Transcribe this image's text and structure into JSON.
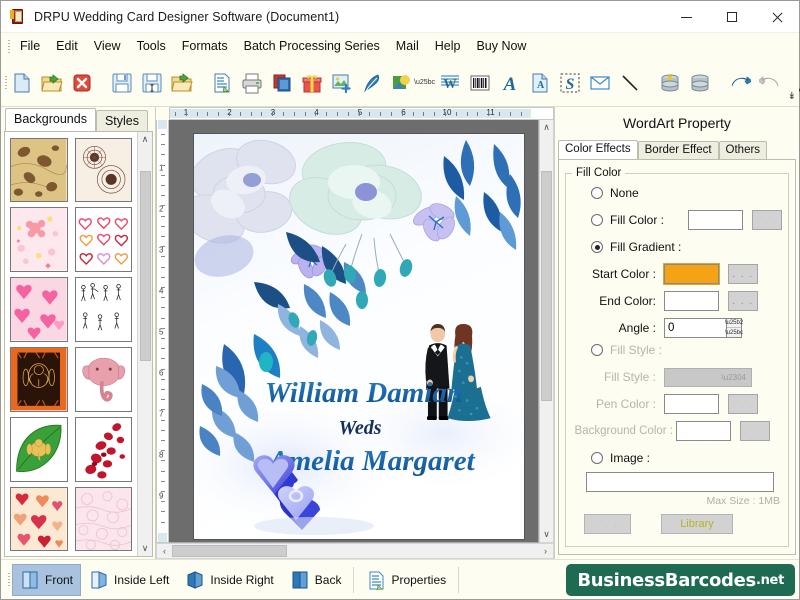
{
  "window": {
    "title": "DRPU Wedding Card Designer Software (Document1)",
    "app_icon": "wedding-card-icon",
    "minimize": "–",
    "maximize": "□",
    "close": "✕"
  },
  "menubar": {
    "items": [
      {
        "label": "File"
      },
      {
        "label": "Edit"
      },
      {
        "label": "View"
      },
      {
        "label": "Tools"
      },
      {
        "label": "Formats"
      },
      {
        "label": "Batch Processing Series"
      },
      {
        "label": "Mail"
      },
      {
        "label": "Help"
      },
      {
        "label": "Buy Now"
      }
    ]
  },
  "toolbar": {
    "overflow": "↡",
    "groups": [
      {
        "buttons": [
          {
            "icon": "new-document-icon",
            "title": "New"
          },
          {
            "icon": "open-folder-icon",
            "title": "Open"
          },
          {
            "icon": "close-document-icon",
            "title": "Close"
          }
        ]
      },
      {
        "buttons": [
          {
            "icon": "save-icon",
            "title": "Save"
          },
          {
            "icon": "save-as-icon",
            "title": "Save As"
          },
          {
            "icon": "export-folder-icon",
            "title": "Export"
          }
        ]
      },
      {
        "buttons": [
          {
            "icon": "print-preview-icon",
            "title": "Print Preview"
          },
          {
            "icon": "printer-icon",
            "title": "Print"
          },
          {
            "icon": "card-templates-icon",
            "title": "Card Templates"
          },
          {
            "icon": "gift-icon",
            "title": "Gift"
          },
          {
            "icon": "add-image-icon",
            "title": "Add Image"
          },
          {
            "icon": "pen-icon",
            "title": "Pen Tool"
          },
          {
            "icon": "shape-picture-icon",
            "title": "Shapes"
          },
          {
            "icon": "watermark-icon",
            "title": "Watermark"
          },
          {
            "icon": "barcode-icon",
            "title": "Barcode"
          },
          {
            "icon": "text-icon",
            "title": "Text"
          },
          {
            "icon": "text-box-icon",
            "title": "Text Box"
          },
          {
            "icon": "wordart-icon",
            "title": "WordArt"
          },
          {
            "icon": "envelope-icon",
            "title": "Envelope"
          },
          {
            "icon": "line-icon",
            "title": "Line"
          }
        ]
      },
      {
        "buttons": [
          {
            "icon": "database-import-icon",
            "title": "Import Database"
          },
          {
            "icon": "database-icon",
            "title": "Database"
          }
        ]
      },
      {
        "buttons": [
          {
            "icon": "undo-icon",
            "title": "Undo"
          },
          {
            "icon": "redo-icon",
            "title": "Redo"
          }
        ]
      },
      {
        "buttons": [
          {
            "icon": "cut-icon",
            "title": "Cut"
          },
          {
            "icon": "copy-icon",
            "title": "Copy"
          },
          {
            "icon": "paste-icon",
            "title": "Paste"
          },
          {
            "icon": "delete-icon",
            "title": "Delete"
          }
        ]
      }
    ]
  },
  "left_panel": {
    "tabs": [
      {
        "label": "Backgrounds",
        "active": true
      },
      {
        "label": "Styles",
        "active": false
      }
    ],
    "thumbnails": [
      {
        "name": "vintage-butterfly-gold"
      },
      {
        "name": "brown-lace-doily"
      },
      {
        "name": "pink-pastel-flowers"
      },
      {
        "name": "heart-outlines-colored"
      },
      {
        "name": "pink-hearts"
      },
      {
        "name": "wedding-couple-sketch"
      },
      {
        "name": "orange-ganesha-motif"
      },
      {
        "name": "pink-elephant"
      },
      {
        "name": "green-leaf-ganesha"
      },
      {
        "name": "red-rose-petals"
      },
      {
        "name": "heart-pattern-collage"
      },
      {
        "name": "pink-damask-texture"
      }
    ],
    "scroll_up": "∧",
    "scroll_down": "∨"
  },
  "canvas": {
    "h_ruler_labels": [
      "1",
      "2",
      "3",
      "4",
      "5",
      "6",
      "10",
      "11"
    ],
    "v_ruler_labels": [
      "1",
      "2",
      "3",
      "4",
      "5",
      "6",
      "7",
      "8",
      "9"
    ],
    "scroll_left": "‹",
    "scroll_right": "›",
    "scroll_up": "∧",
    "scroll_down": "∨",
    "card": {
      "groom_name": "William Damian",
      "weds_text": "Weds",
      "bride_name": "Amelia Margaret",
      "background_theme": "blue-floral-watercolor",
      "illustrations": [
        "bride-groom-couple",
        "heart-ring-box",
        "blue-flowers",
        "blue-leaves"
      ]
    }
  },
  "right_panel": {
    "title": "WordArt Property",
    "tabs": [
      {
        "label": "Color Effects",
        "active": true
      },
      {
        "label": "Border Effect",
        "active": false
      },
      {
        "label": "Others",
        "active": false
      }
    ],
    "group_legend": "Fill Color",
    "options": {
      "none_label": "None",
      "none_selected": false,
      "fill_color_label": "Fill Color :",
      "fill_color_selected": false,
      "fill_color_value": "#FFFFFF",
      "fill_gradient_label": "Fill Gradient :",
      "fill_gradient_selected": true,
      "start_color_label": "Start Color :",
      "start_color_value": "#F5A214",
      "end_color_label": "End Color:",
      "end_color_value": "#FFFFFF",
      "angle_label": "Angle :",
      "angle_value": "0",
      "fill_style_label": "Fill Style :",
      "fill_style_selected": false,
      "fill_style_field_label": "Fill Style :",
      "fill_style_value": "",
      "pen_color_label": "Pen Color :",
      "pen_color_value": "#FFFFFF",
      "background_color_label": "Background Color :",
      "background_color_value": "#FFFFFF",
      "image_label": "Image :",
      "image_selected": false,
      "image_path": "",
      "max_size_text": "Max Size : 1MB",
      "browse_label": ". . .",
      "library_label": "Library"
    }
  },
  "statusbar": {
    "items": [
      {
        "label": "Front",
        "icon": "card-front-icon",
        "active": true
      },
      {
        "label": "Inside Left",
        "icon": "card-inside-left-icon",
        "active": false
      },
      {
        "label": "Inside Right",
        "icon": "card-inside-right-icon",
        "active": false
      },
      {
        "label": "Back",
        "icon": "card-back-icon",
        "active": false
      },
      {
        "label": "Properties",
        "icon": "properties-icon",
        "active": false
      }
    ],
    "brand": "BusinessBarcodes",
    "brand_tld": ".net"
  },
  "colors": {
    "window_bg": "#FDFDF2",
    "accent_orange": "#F5A214",
    "brand_green": "#1F6B52",
    "selection_blue": "#A9C2DE",
    "canvas_gray": "#6D6D6D"
  }
}
